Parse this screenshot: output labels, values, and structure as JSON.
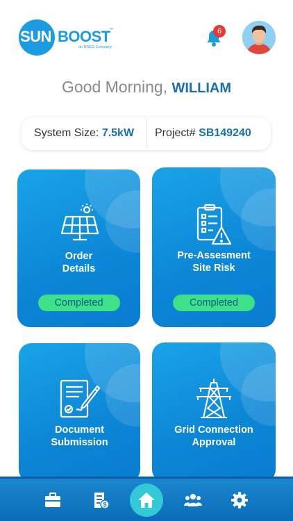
{
  "header": {
    "logo_sun": "SUN",
    "logo_boost": "BOOST",
    "logo_tm": "™",
    "logo_sub": "an NSEG Company",
    "notification_count": "6"
  },
  "greeting": {
    "prefix": "Good Morning,",
    "name": "WILLIAM"
  },
  "info": {
    "system_size_label": "System Size:",
    "system_size_value": "7.5kW",
    "project_label": "Project#",
    "project_value": "SB149240"
  },
  "cards": [
    {
      "title_line1": "Order",
      "title_line2": "Details",
      "status": "Completed",
      "icon": "solar-panel-icon"
    },
    {
      "title_line1": "Pre-Assesment",
      "title_line2": "Site Risk",
      "status": "Completed",
      "icon": "checklist-warning-icon"
    },
    {
      "title_line1": "Document",
      "title_line2": "Submission",
      "icon": "document-sign-icon"
    },
    {
      "title_line1": "Grid Connection",
      "title_line2": "Approval",
      "icon": "power-tower-icon"
    }
  ],
  "nav": {
    "items": [
      "briefcase-icon",
      "invoice-icon",
      "home-icon",
      "team-icon",
      "settings-icon"
    ],
    "active": "home-icon"
  },
  "colors": {
    "brand_blue": "#1c9be0",
    "accent_text": "#1a6fb0",
    "status_green": "#3fe08a",
    "nav_home": "#33c9d6",
    "badge_red": "#e53935"
  }
}
